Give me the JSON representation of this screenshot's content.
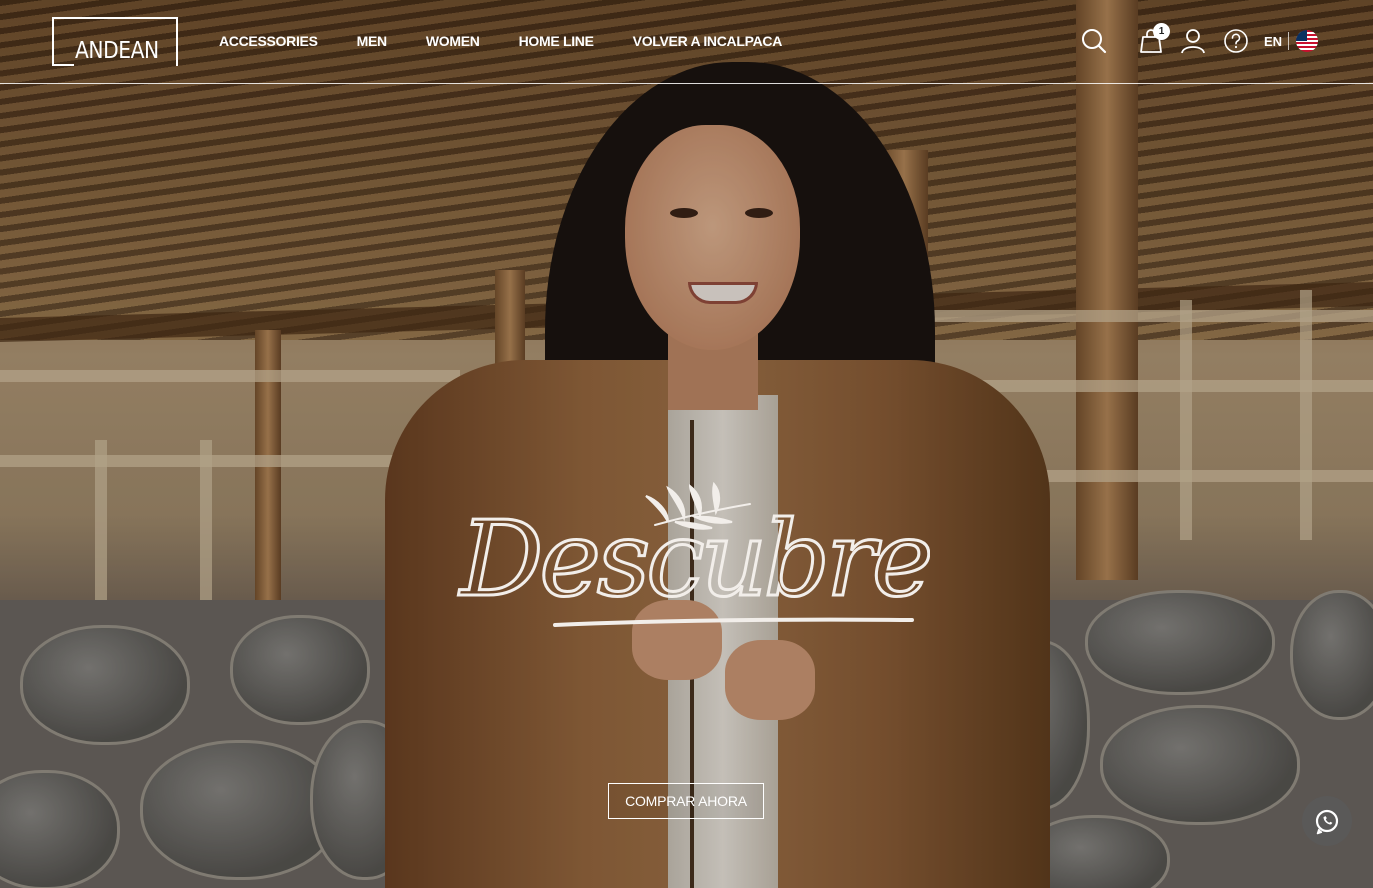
{
  "brand": {
    "logo_text": "ANDEAN"
  },
  "nav": {
    "items": [
      {
        "label": "ACCESSORIES"
      },
      {
        "label": "MEN"
      },
      {
        "label": "WOMEN"
      },
      {
        "label": "HOME LINE"
      },
      {
        "label": "VOLVER A INCALPACA"
      }
    ]
  },
  "header_icons": {
    "search": "search-icon",
    "cart": "shopping-bag-icon",
    "cart_count": "1",
    "account": "user-icon",
    "help": "help-icon",
    "language": "EN",
    "flag": "us-flag-icon"
  },
  "hero": {
    "script_text": "Descubre",
    "cta_label": "COMPRAR AHORA"
  },
  "floating": {
    "chat": "whatsapp-icon"
  },
  "colors": {
    "header_text": "#ffffff",
    "cta_border": "#ffffff",
    "chat_bg": "#5a5a5a"
  }
}
